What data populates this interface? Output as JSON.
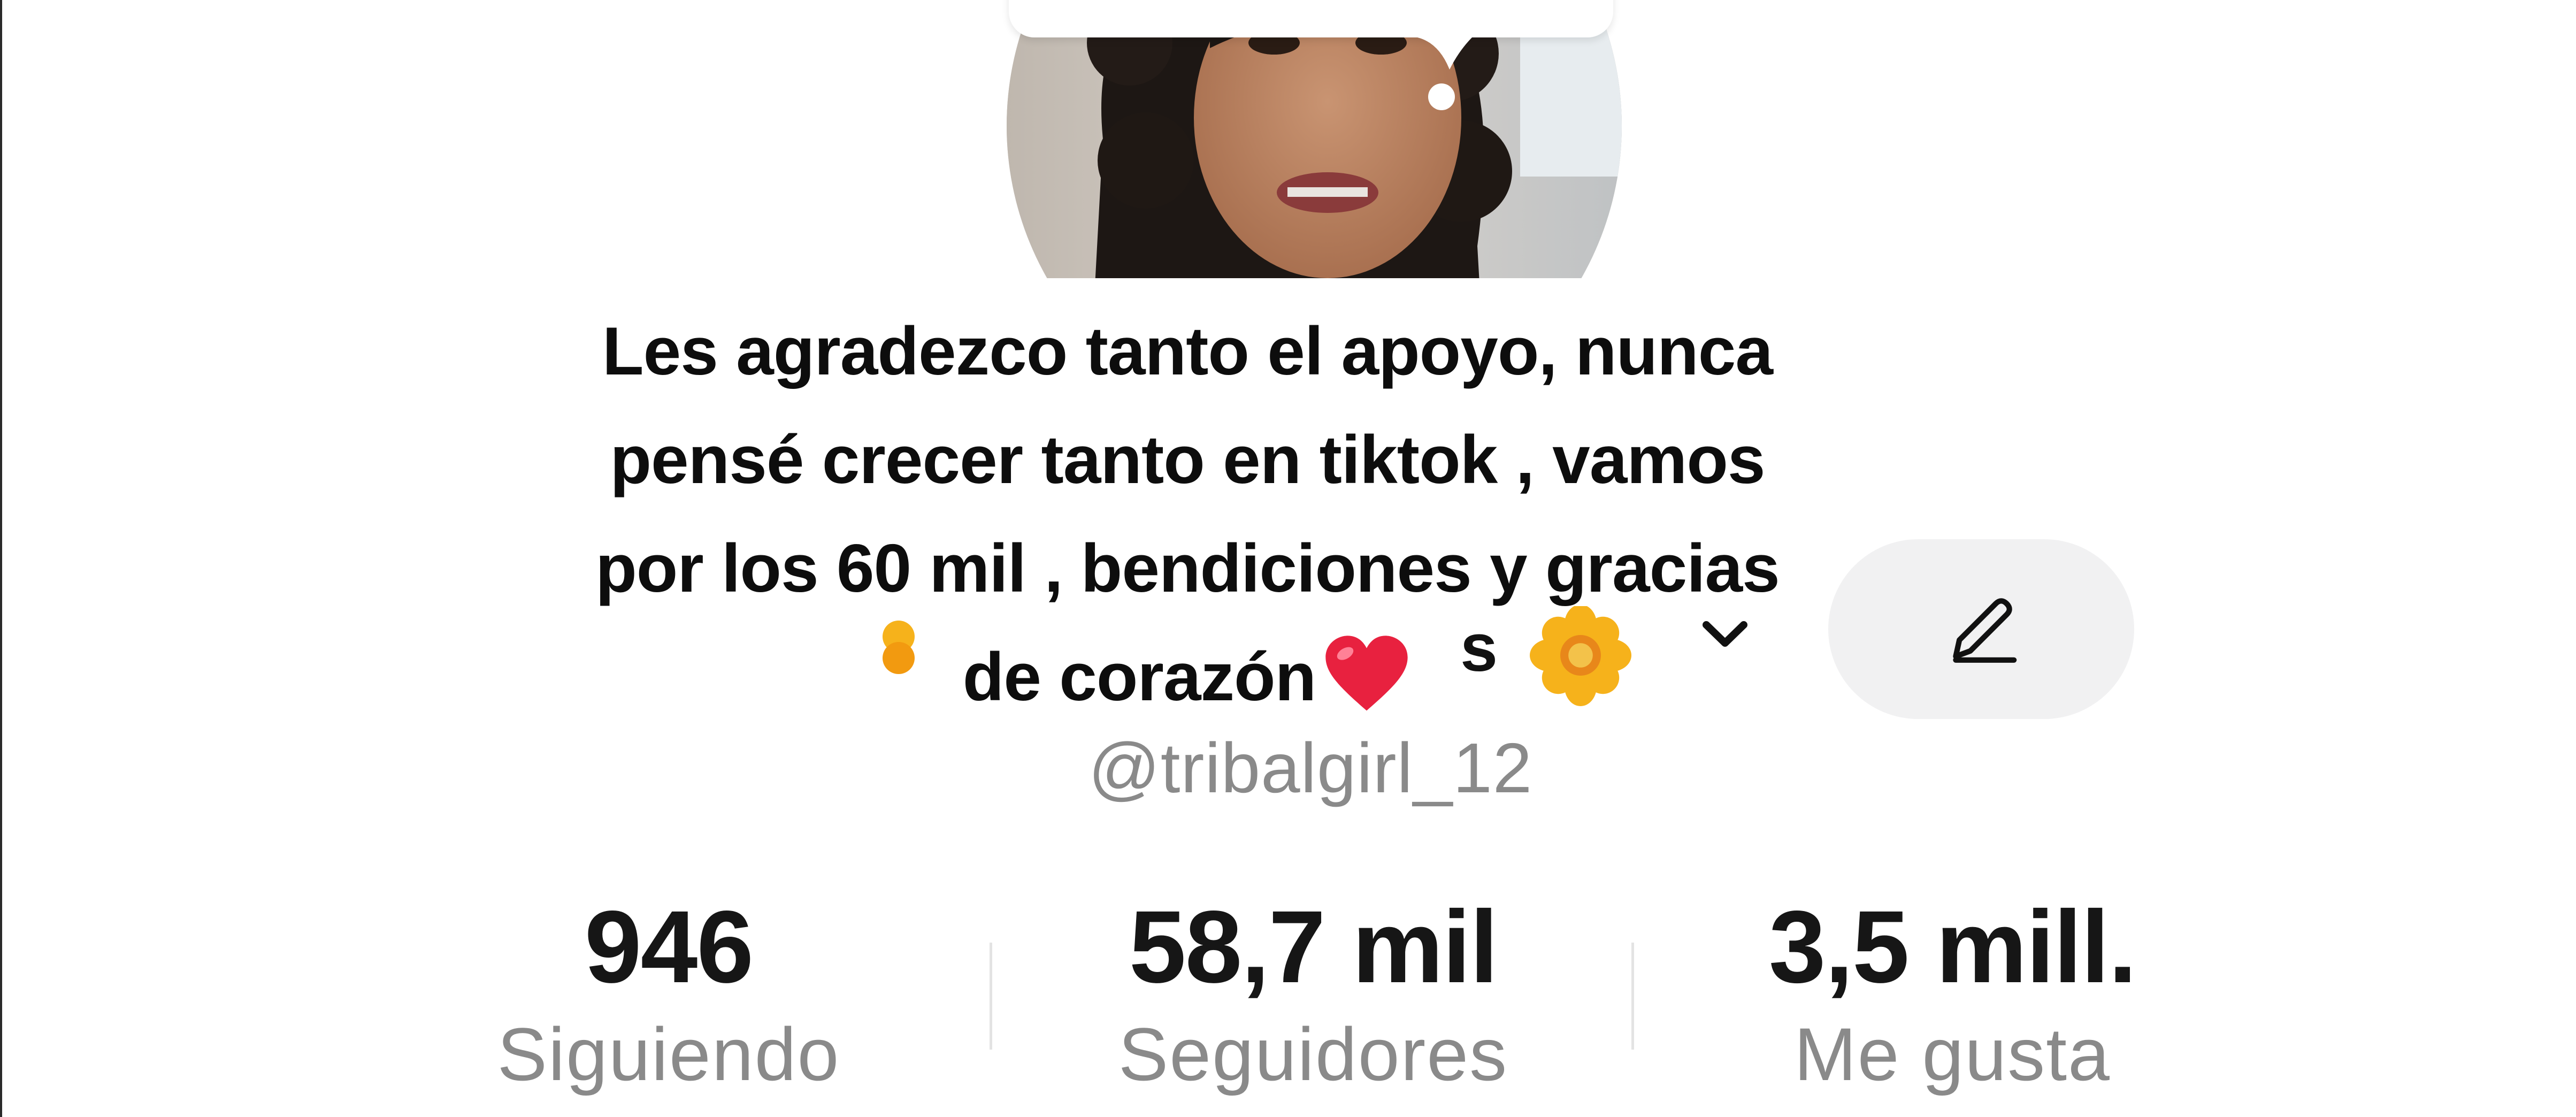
{
  "profile": {
    "name_fragment": "s",
    "handle": "@tribalgirl_12",
    "caption_lines": [
      "Les agradezco tanto el apoyo, nunca",
      "pensé crecer tanto en tiktok , vamos",
      "por los 60 mil , bendiciones y gracias",
      "de corazón"
    ],
    "caption_emoji": "heart-emoji",
    "name_decoration": "sunflower-emoji"
  },
  "stats": [
    {
      "value": "946",
      "label": "Siguiendo"
    },
    {
      "value": "58,7 mil",
      "label": "Seguidores"
    },
    {
      "value": "3,5 mill.",
      "label": "Me gusta"
    }
  ],
  "icons": {
    "edit": "pencil-icon",
    "dropdown": "chevron-down-icon"
  },
  "colors": {
    "text_primary": "#161616",
    "text_secondary": "#8a8a8a",
    "button_bg": "#f1f1f2",
    "heart": "#e8213f",
    "flower": "#f6b21b"
  }
}
